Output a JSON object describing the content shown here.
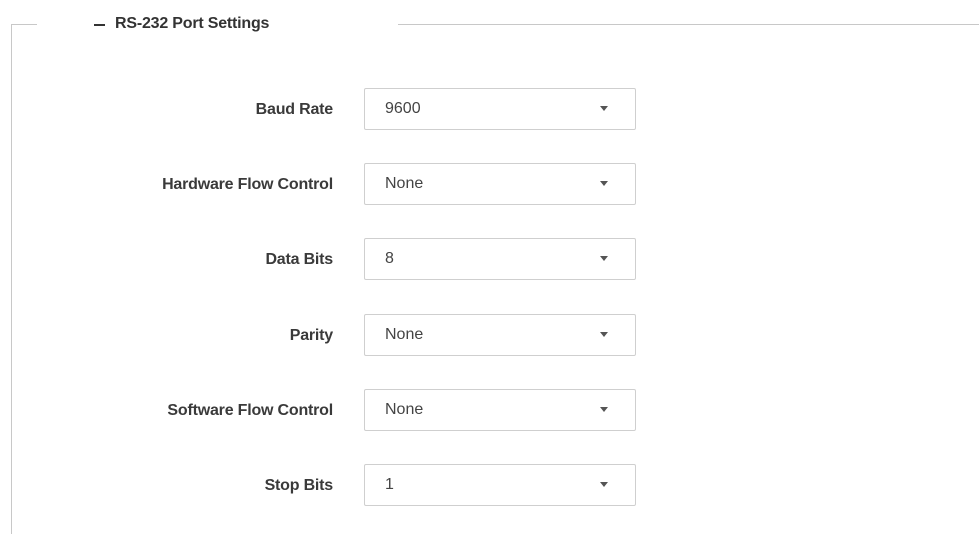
{
  "group": {
    "title": "RS-232 Port Settings",
    "collapse_icon": "minus-icon"
  },
  "fields": [
    {
      "label": "Baud Rate",
      "value": "9600"
    },
    {
      "label": "Hardware Flow Control",
      "value": "None"
    },
    {
      "label": "Data Bits",
      "value": "8"
    },
    {
      "label": "Parity",
      "value": "None"
    },
    {
      "label": "Software Flow Control",
      "value": "None"
    },
    {
      "label": "Stop Bits",
      "value": "1"
    }
  ],
  "icons": {
    "dropdown": "caret-down-icon"
  },
  "colors": {
    "border": "#c8c8c8",
    "text": "#333333"
  }
}
